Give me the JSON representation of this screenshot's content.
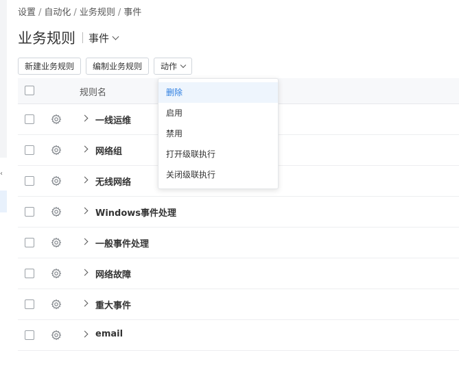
{
  "breadcrumb": [
    "设置",
    "自动化",
    "业务规则",
    "事件"
  ],
  "breadcrumb_sep": "/",
  "page_title": "业务规则",
  "subtitle": "事件",
  "toolbar": {
    "new_label": "新建业务规则",
    "edit_label": "编制业务规则",
    "action_label": "动作"
  },
  "table": {
    "header_name": "规则名",
    "rows": [
      {
        "name": "一线运维"
      },
      {
        "name": "网络组"
      },
      {
        "name": "无线网络"
      },
      {
        "name": "Windows事件处理"
      },
      {
        "name": "一般事件处理"
      },
      {
        "name": "网络故障"
      },
      {
        "name": "重大事件"
      },
      {
        "name": "email"
      }
    ]
  },
  "dropdown": {
    "items": [
      "删除",
      "启用",
      "禁用",
      "打开级联执行",
      "关闭级联执行"
    ],
    "active_index": 0,
    "active_color": "#2d7ee0"
  },
  "left_panel": {
    "caret": "‹"
  }
}
